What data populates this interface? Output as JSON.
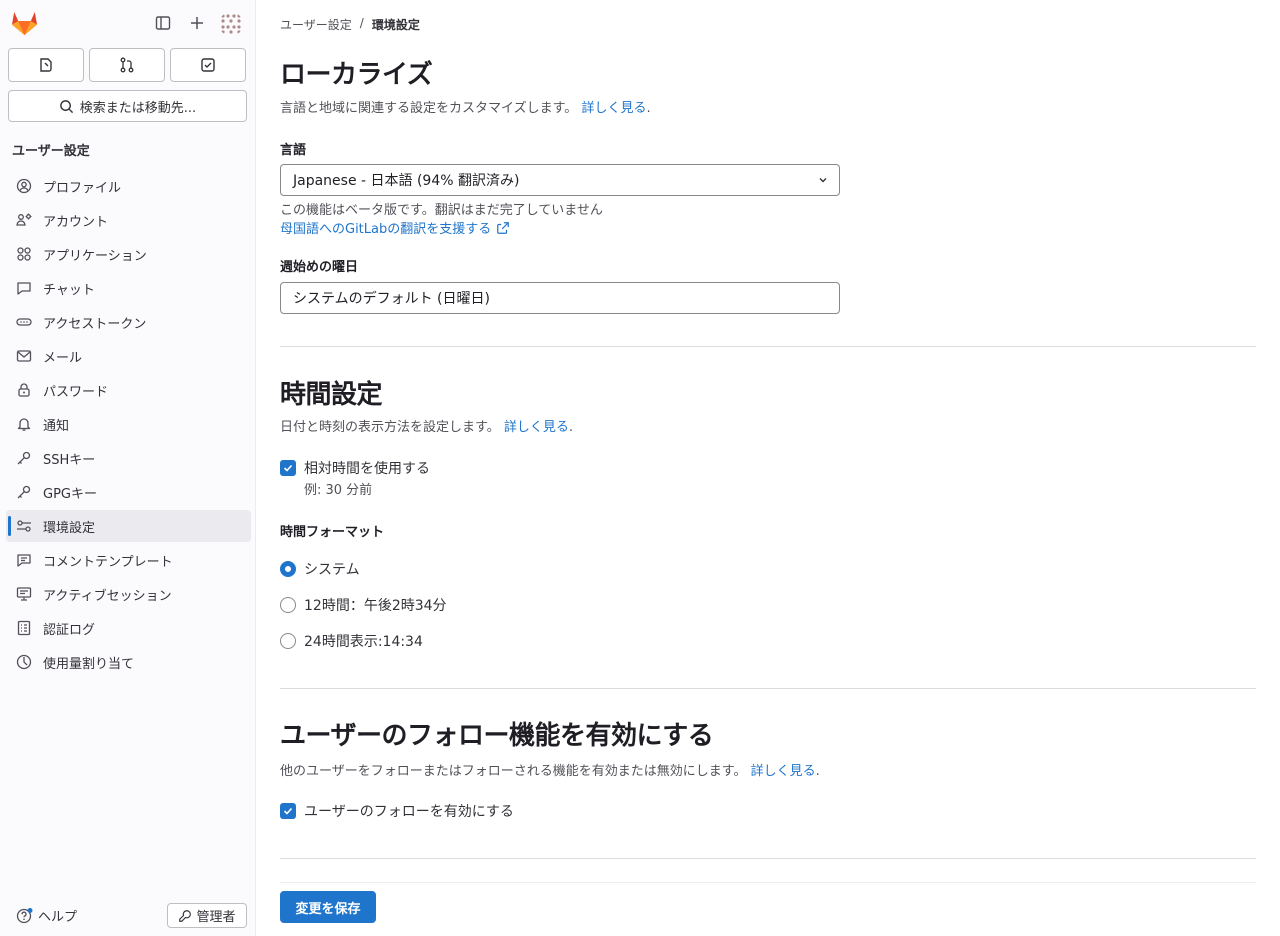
{
  "sidebar": {
    "search_label": "検索または移動先...",
    "section_title": "ユーザー設定",
    "items": [
      {
        "label": "プロファイル",
        "icon": "profile-icon"
      },
      {
        "label": "アカウント",
        "icon": "account-icon"
      },
      {
        "label": "アプリケーション",
        "icon": "applications-icon"
      },
      {
        "label": "チャット",
        "icon": "chat-icon"
      },
      {
        "label": "アクセストークン",
        "icon": "token-icon"
      },
      {
        "label": "メール",
        "icon": "mail-icon"
      },
      {
        "label": "パスワード",
        "icon": "lock-icon"
      },
      {
        "label": "通知",
        "icon": "bell-icon"
      },
      {
        "label": "SSHキー",
        "icon": "key-icon"
      },
      {
        "label": "GPGキー",
        "icon": "key-icon"
      },
      {
        "label": "環境設定",
        "icon": "preferences-icon",
        "active": true
      },
      {
        "label": "コメントテンプレート",
        "icon": "comment-icon"
      },
      {
        "label": "アクティブセッション",
        "icon": "monitor-icon"
      },
      {
        "label": "認証ログ",
        "icon": "log-icon"
      },
      {
        "label": "使用量割り当て",
        "icon": "quota-icon"
      }
    ],
    "help_label": "ヘルプ",
    "admin_label": "管理者"
  },
  "breadcrumb": {
    "parent": "ユーザー設定",
    "separator": "/",
    "current": "環境設定"
  },
  "localization": {
    "title": "ローカライズ",
    "description": "言語と地域に関連する設定をカスタマイズします。",
    "learn_more": "詳しく見る",
    "language_label": "言語",
    "language_value": "Japanese - 日本語 (94% 翻訳済み)",
    "beta_note": "この機能はベータ版です。翻訳はまだ完了していません",
    "help_translate": "母国語へのGitLabの翻訳を支援する",
    "week_start_label": "週始めの曜日",
    "week_start_value": "システムのデフォルト (日曜日)"
  },
  "time": {
    "title": "時間設定",
    "description": "日付と時刻の表示方法を設定します。",
    "learn_more": "詳しく見る",
    "relative_label": "相対時間を使用する",
    "relative_example": "例: 30 分前",
    "format_label": "時間フォーマット",
    "formats": [
      {
        "label": "システム",
        "selected": true
      },
      {
        "label": "12時間：午後2時34分",
        "selected": false
      },
      {
        "label": "24時間表示:14:34",
        "selected": false
      }
    ]
  },
  "follow": {
    "title": "ユーザーのフォロー機能を有効にする",
    "description": "他のユーザーをフォローまたはフォローされる機能を有効または無効にします。",
    "learn_more": "詳しく見る",
    "checkbox_label": "ユーザーのフォローを有効にする"
  },
  "save_label": "変更を保存",
  "colors": {
    "accent": "#1f75cb",
    "sidebar_bg": "#fbfafd"
  }
}
